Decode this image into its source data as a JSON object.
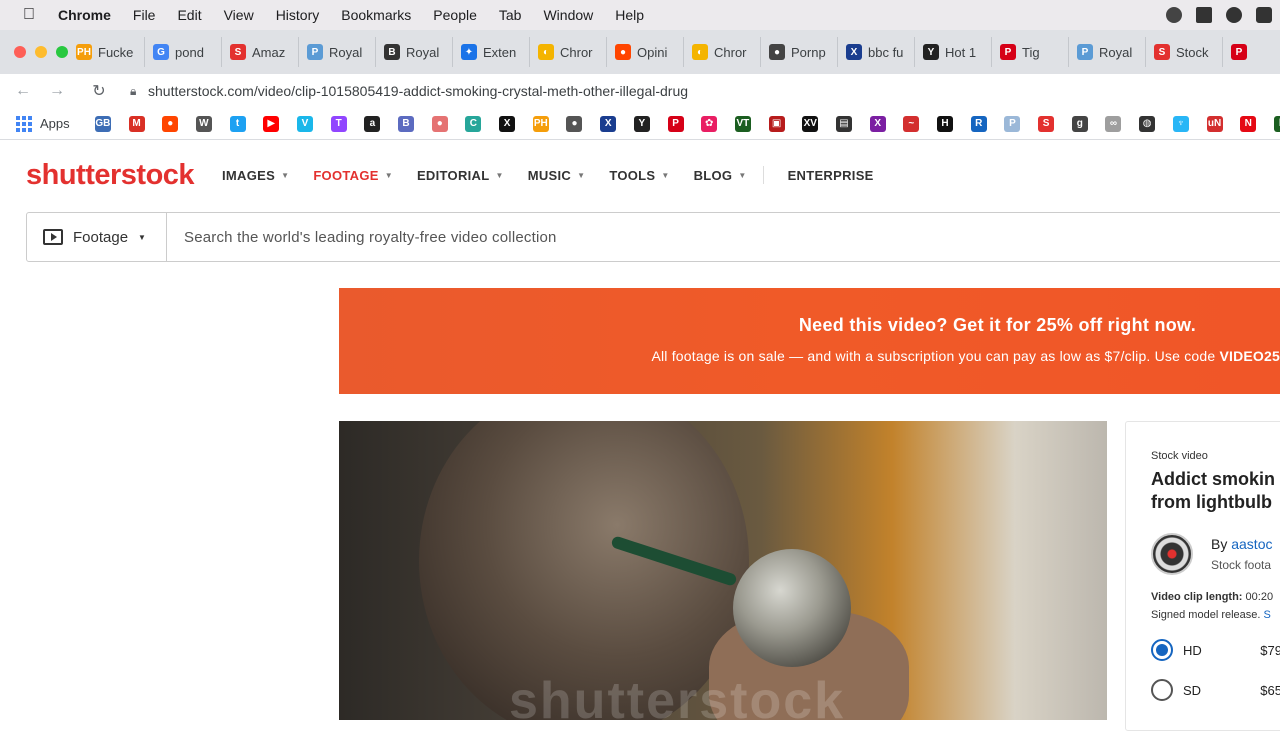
{
  "menubar": {
    "app": "Chrome",
    "items": [
      "File",
      "Edit",
      "View",
      "History",
      "Bookmarks",
      "People",
      "Tab",
      "Window",
      "Help"
    ]
  },
  "tabs": [
    {
      "label": "Fucke",
      "color": "#f59e0b",
      "glyph": "PH"
    },
    {
      "label": "pond",
      "color": "#4285f4",
      "glyph": "G"
    },
    {
      "label": "Amaz",
      "color": "#e3312f",
      "glyph": "S"
    },
    {
      "label": "Royal",
      "color": "#5b9bd5",
      "glyph": "P"
    },
    {
      "label": "Royal",
      "color": "#333333",
      "glyph": "B"
    },
    {
      "label": "Exten",
      "color": "#1a73e8",
      "glyph": "✦"
    },
    {
      "label": "Chror",
      "color": "#f4b400",
      "glyph": "◐"
    },
    {
      "label": "Opini",
      "color": "#ff4500",
      "glyph": "●"
    },
    {
      "label": "Chror",
      "color": "#f4b400",
      "glyph": "◐"
    },
    {
      "label": "Pornp",
      "color": "#444444",
      "glyph": "●"
    },
    {
      "label": "bbc fu",
      "color": "#1a3d8f",
      "glyph": "X"
    },
    {
      "label": "Hot 1",
      "color": "#222222",
      "glyph": "Y"
    },
    {
      "label": "Tig",
      "color": "#d60017",
      "glyph": "P"
    },
    {
      "label": "Royal",
      "color": "#5b9bd5",
      "glyph": "P"
    },
    {
      "label": "Stock",
      "color": "#e3312f",
      "glyph": "S"
    },
    {
      "label": "",
      "color": "#d60017",
      "glyph": "P"
    }
  ],
  "address": {
    "url": "shutterstock.com/video/clip-1015805419-addict-smoking-crystal-meth-other-illegal-drug"
  },
  "bookmarks": {
    "apps_label": "Apps",
    "icons": [
      {
        "name": "gb",
        "color": "#3d6db5",
        "glyph": "GB"
      },
      {
        "name": "gmail",
        "color": "#d93025",
        "glyph": "M"
      },
      {
        "name": "reddit",
        "color": "#ff4500",
        "glyph": "●"
      },
      {
        "name": "wikipedia",
        "color": "#555555",
        "glyph": "W"
      },
      {
        "name": "twitter",
        "color": "#1da1f2",
        "glyph": "t"
      },
      {
        "name": "youtube",
        "color": "#ff0000",
        "glyph": "▶"
      },
      {
        "name": "vimeo",
        "color": "#1ab7ea",
        "glyph": "V"
      },
      {
        "name": "twitch",
        "color": "#9146ff",
        "glyph": "T"
      },
      {
        "name": "amazon",
        "color": "#222222",
        "glyph": "a"
      },
      {
        "name": "bag",
        "color": "#5c6bc0",
        "glyph": "B"
      },
      {
        "name": "brain",
        "color": "#e57373",
        "glyph": "●"
      },
      {
        "name": "cam",
        "color": "#26a69a",
        "glyph": "C"
      },
      {
        "name": "x1",
        "color": "#111111",
        "glyph": "X"
      },
      {
        "name": "ph",
        "color": "#f59e0b",
        "glyph": "PH"
      },
      {
        "name": "pug",
        "color": "#555555",
        "glyph": "●"
      },
      {
        "name": "x2",
        "color": "#1a3d8f",
        "glyph": "X"
      },
      {
        "name": "y",
        "color": "#222222",
        "glyph": "Y"
      },
      {
        "name": "p1",
        "color": "#d60017",
        "glyph": "P"
      },
      {
        "name": "flower",
        "color": "#e91e63",
        "glyph": "✿"
      },
      {
        "name": "vt",
        "color": "#1b5e20",
        "glyph": "VT"
      },
      {
        "name": "tv",
        "color": "#b71c1c",
        "glyph": "▣"
      },
      {
        "name": "xv",
        "color": "#111111",
        "glyph": "XV"
      },
      {
        "name": "bus",
        "color": "#333333",
        "glyph": "▤"
      },
      {
        "name": "x3",
        "color": "#7b1fa2",
        "glyph": "X"
      },
      {
        "name": "red",
        "color": "#d32f2f",
        "glyph": "~"
      },
      {
        "name": "h",
        "color": "#111111",
        "glyph": "H"
      },
      {
        "name": "r",
        "color": "#1565c0",
        "glyph": "R"
      },
      {
        "name": "p2",
        "color": "#9bb8d8",
        "glyph": "P"
      },
      {
        "name": "s",
        "color": "#e3312f",
        "glyph": "S"
      },
      {
        "name": "g",
        "color": "#444444",
        "glyph": "g"
      },
      {
        "name": "inf",
        "color": "#9e9e9e",
        "glyph": "∞"
      },
      {
        "name": "globe",
        "color": "#333333",
        "glyph": "◍"
      },
      {
        "name": "tree",
        "color": "#29b6f6",
        "glyph": "♆"
      },
      {
        "name": "un",
        "color": "#d32f2f",
        "glyph": "uN"
      },
      {
        "name": "n",
        "color": "#e50914",
        "glyph": "N"
      },
      {
        "name": "h2",
        "color": "#1b5e20",
        "glyph": "h"
      }
    ]
  },
  "site": {
    "logo": "shutterstock",
    "nav": [
      {
        "label": "IMAGES",
        "active": false
      },
      {
        "label": "FOOTAGE",
        "active": true
      },
      {
        "label": "EDITORIAL",
        "active": false
      },
      {
        "label": "MUSIC",
        "active": false
      },
      {
        "label": "TOOLS",
        "active": false
      },
      {
        "label": "BLOG",
        "active": false
      }
    ],
    "enterprise": "ENTERPRISE"
  },
  "search": {
    "scope": "Footage",
    "placeholder": "Search the world's leading royalty-free video collection"
  },
  "promo": {
    "headline": "Need this video? Get it for 25% off right now.",
    "subtext": "All footage is on sale — and with a subscription you can pay as low as $7/clip. Use code ",
    "code": "VIDEO25"
  },
  "video": {
    "watermark": "shutterstock"
  },
  "panel": {
    "label": "Stock video",
    "title_line1": "Addict smokin",
    "title_line2": "from lightbulb",
    "by": "By",
    "author": "aastoc",
    "author_sub": "Stock foota",
    "clip_length_label": "Video clip length:",
    "clip_length": "00:20",
    "release": "Signed model release.",
    "release_link": "S",
    "options": [
      {
        "label": "HD",
        "price": "$79",
        "selected": true
      },
      {
        "label": "SD",
        "price": "$65",
        "selected": false
      }
    ]
  }
}
